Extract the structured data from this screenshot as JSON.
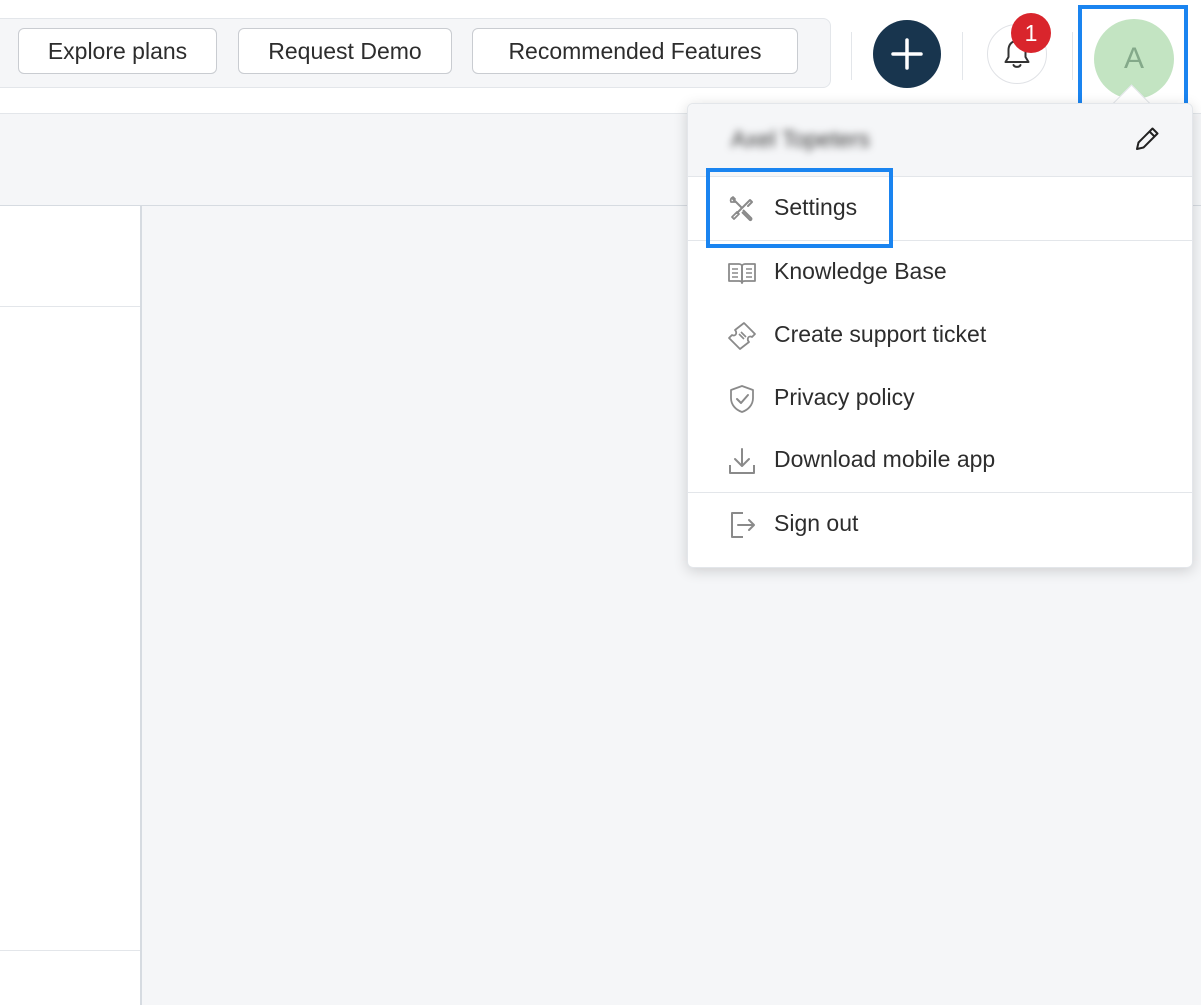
{
  "header": {
    "promo_buttons": [
      "Explore plans",
      "Request Demo",
      "Recommended Features"
    ],
    "notification_count": "1",
    "avatar_initial": "A"
  },
  "user_menu": {
    "user_name": "Axel Topeters",
    "items": [
      {
        "label": "Settings",
        "icon": "settings-tools-icon"
      },
      {
        "label": "Knowledge Base",
        "icon": "book-icon"
      },
      {
        "label": "Create support ticket",
        "icon": "ticket-icon"
      },
      {
        "label": "Privacy policy",
        "icon": "shield-check-icon"
      },
      {
        "label": "Download mobile app",
        "icon": "download-icon"
      },
      {
        "label": "Sign out",
        "icon": "sign-out-icon"
      }
    ]
  },
  "colors": {
    "highlight": "#1a84f0",
    "plus_button": "#18354e",
    "badge": "#d9252c",
    "avatar_bg": "#c3e4c2"
  }
}
